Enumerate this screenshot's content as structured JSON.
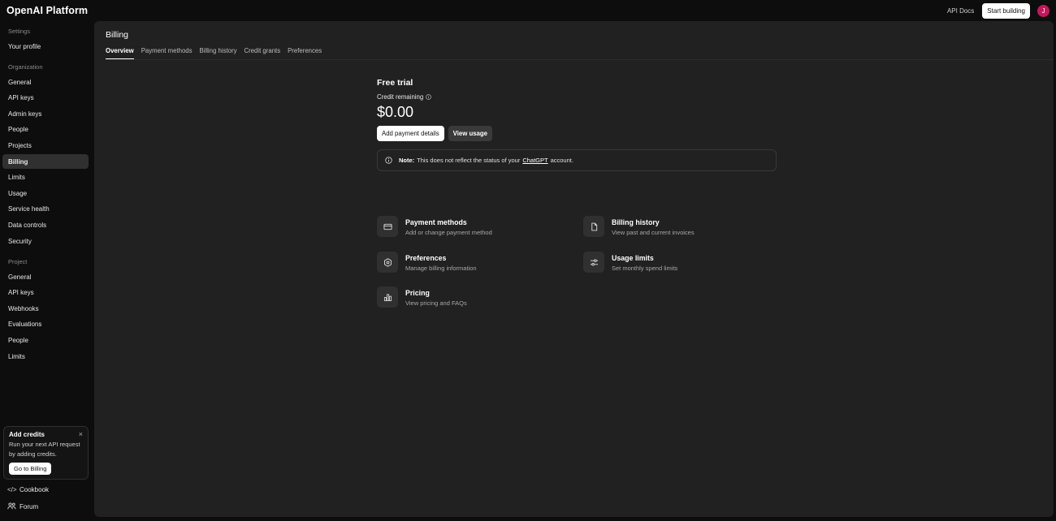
{
  "header": {
    "brand": "OpenAI Platform",
    "api_docs": "API Docs",
    "start_building": "Start building",
    "avatar_initial": "J",
    "avatar_color": "#c2185b"
  },
  "sidebar": {
    "settings_title": "Settings",
    "settings_items": [
      {
        "label": "Your profile"
      }
    ],
    "organization_title": "Organization",
    "organization_items": [
      {
        "label": "General"
      },
      {
        "label": "API keys"
      },
      {
        "label": "Admin keys"
      },
      {
        "label": "People"
      },
      {
        "label": "Projects"
      },
      {
        "label": "Billing"
      },
      {
        "label": "Limits"
      },
      {
        "label": "Usage"
      },
      {
        "label": "Service health"
      },
      {
        "label": "Data controls"
      },
      {
        "label": "Security"
      }
    ],
    "project_title": "Project",
    "project_items": [
      {
        "label": "General"
      },
      {
        "label": "API keys"
      },
      {
        "label": "Webhooks"
      },
      {
        "label": "Evaluations"
      },
      {
        "label": "People"
      },
      {
        "label": "Limits"
      }
    ],
    "credits_card": {
      "title": "Add credits",
      "body": "Run your next API request by adding credits.",
      "button": "Go to Billing"
    },
    "footer": [
      {
        "label": "Cookbook",
        "icon": "code-icon"
      },
      {
        "label": "Forum",
        "icon": "people-icon"
      }
    ]
  },
  "main": {
    "title": "Billing",
    "tabs": [
      {
        "label": "Overview"
      },
      {
        "label": "Payment methods"
      },
      {
        "label": "Billing history"
      },
      {
        "label": "Credit grants"
      },
      {
        "label": "Preferences"
      }
    ],
    "plan_title": "Free trial",
    "credit_label": "Credit remaining",
    "credit_amount": "$0.00",
    "add_payment": "Add payment details",
    "view_usage": "View usage",
    "note": {
      "label": "Note:",
      "text_before": "This does not reflect the status of your",
      "link": "ChatGPT",
      "text_after": "account."
    },
    "cards": [
      {
        "title": "Payment methods",
        "desc": "Add or change payment method",
        "icon": "credit-card-icon"
      },
      {
        "title": "Billing history",
        "desc": "View past and current invoices",
        "icon": "document-icon"
      },
      {
        "title": "Preferences",
        "desc": "Manage billing information",
        "icon": "settings-gear-icon"
      },
      {
        "title": "Usage limits",
        "desc": "Set monthly spend limits",
        "icon": "sliders-icon"
      },
      {
        "title": "Pricing",
        "desc": "View pricing and FAQs",
        "icon": "bar-chart-icon"
      }
    ]
  }
}
